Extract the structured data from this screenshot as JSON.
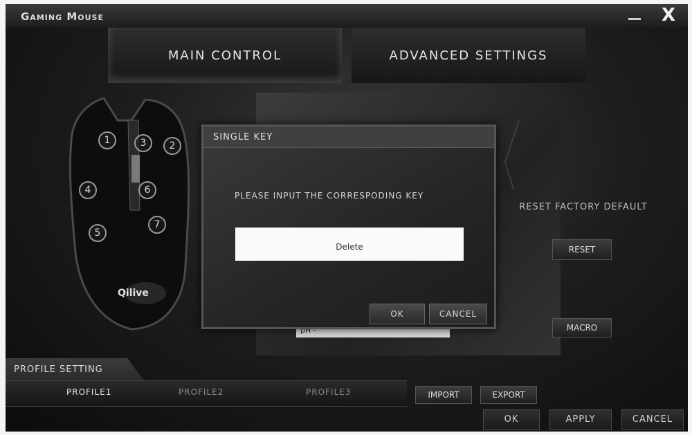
{
  "window": {
    "title": "Gaming Mouse",
    "close_label": "X"
  },
  "tabs": [
    {
      "label": "MAIN CONTROL"
    },
    {
      "label": "ADVANCED SETTINGS"
    }
  ],
  "mouse": {
    "buttons": [
      "1",
      "2",
      "3",
      "4",
      "5",
      "6",
      "7"
    ],
    "brand": "Qilive"
  },
  "dialog": {
    "title": "SINGLE KEY",
    "prompt": "PLEASE INPUT THE CORRESPODING KEY",
    "input_value": "Delete",
    "ok_label": "OK",
    "cancel_label": "CANCEL"
  },
  "right_panel": {
    "reset_heading": "RESET FACTORY DEFAULT",
    "reset_label": "RESET",
    "macro_label": "MACRO"
  },
  "dropdown": {
    "value": "pH -"
  },
  "profile": {
    "section_label": "PROFILE SETTING",
    "tabs": [
      "PROFILE1",
      "PROFILE2",
      "PROFILE3"
    ],
    "import_label": "IMPORT",
    "export_label": "EXPORT"
  },
  "footer": {
    "ok_label": "OK",
    "apply_label": "APPLY",
    "cancel_label": "CANCEL"
  },
  "colors": {
    "accent": "#e0e0e0",
    "background": "#141414"
  }
}
